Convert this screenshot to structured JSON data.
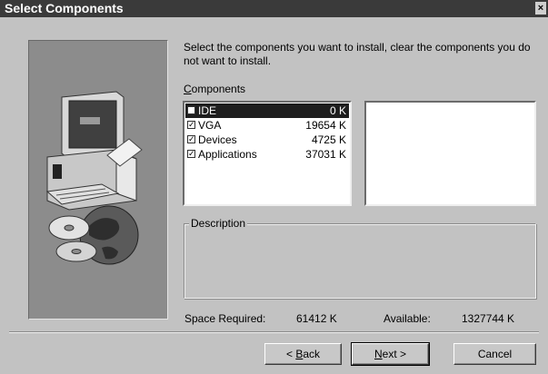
{
  "window": {
    "title": "Select Components",
    "close_glyph": "×"
  },
  "instructions": "Select the components you want to install, clear the components you do not want to install.",
  "components_label_accel": "C",
  "components_label_rest": "omponents",
  "components": [
    {
      "name": "IDE",
      "size": "0 K",
      "checked": false,
      "selected": true
    },
    {
      "name": "VGA",
      "size": "19654 K",
      "checked": true,
      "selected": false
    },
    {
      "name": "Devices",
      "size": "4725 K",
      "checked": true,
      "selected": false
    },
    {
      "name": "Applications",
      "size": "37031 K",
      "checked": true,
      "selected": false
    }
  ],
  "description": {
    "legend": "Description",
    "text": ""
  },
  "space": {
    "required_label": "Space Required:",
    "required_value": "61412 K",
    "available_label": "Available:",
    "available_value": "1327744 K"
  },
  "buttons": {
    "back_prefix": "< ",
    "back_accel": "B",
    "back_rest": "ack",
    "next_accel": "N",
    "next_rest": "ext >",
    "cancel": "Cancel"
  },
  "icons": {
    "check": "✓",
    "art": "computer-with-disc-icon"
  }
}
